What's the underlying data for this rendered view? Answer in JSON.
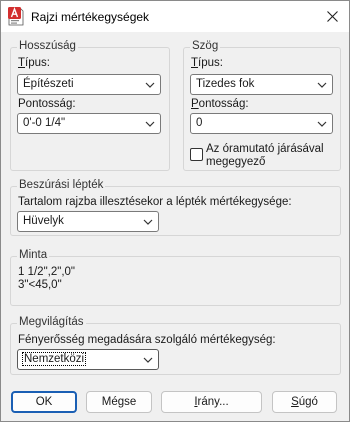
{
  "window": {
    "title": "Rajzi mértékegységek"
  },
  "length": {
    "legend": "Hosszúság",
    "type_label": "Típus:",
    "type_value": "Építészeti",
    "precision_label": "Pontosság:",
    "precision_value": "0'-0 1/4\""
  },
  "angle": {
    "legend": "Szög",
    "type_label": "Típus:",
    "type_value": "Tizedes fok",
    "precision_label": "Pontosság:",
    "precision_value": "0",
    "clockwise_label_line1": "Az óramutató járásával",
    "clockwise_label_line2": "megegyező",
    "clockwise_checked": false
  },
  "insertion_scale": {
    "legend": "Beszúrási lépték",
    "description": "Tartalom rajzba illesztésekor a lépték mértékegysége:",
    "value": "Hüvelyk"
  },
  "sample": {
    "legend": "Minta",
    "line1": "1 1/2\",2\",0\"",
    "line2": "3\"<45,0\""
  },
  "lighting": {
    "legend": "Megvilágítás",
    "description": "Fényerősség megadására szolgáló mértékegység:",
    "value": "Nemzetközi"
  },
  "buttons": {
    "ok": "OK",
    "cancel": "Mégse",
    "direction": "Irány...",
    "help": "Súgó"
  },
  "colors": {
    "accent": "#1a5fb4",
    "app_icon": "#d32f2f"
  }
}
